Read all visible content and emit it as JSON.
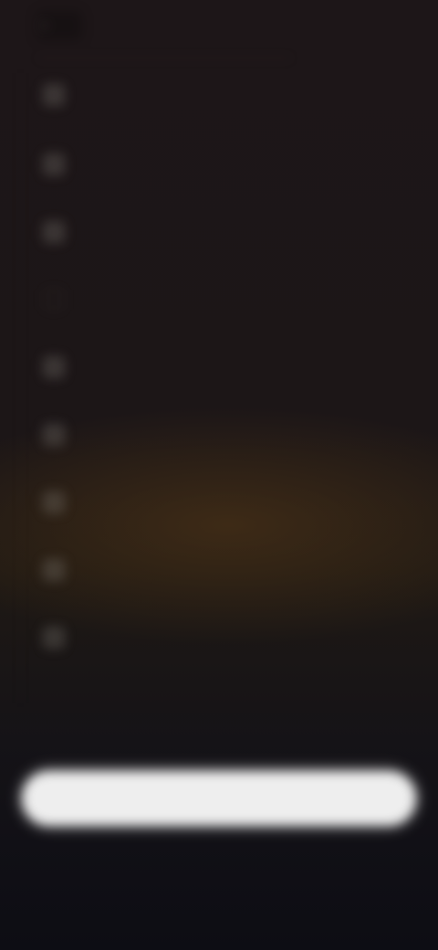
{
  "header": {
    "back_label": "",
    "action_label": ""
  },
  "menu": {
    "items": [
      {
        "icon": "square-icon",
        "label": ""
      },
      {
        "icon": "square-icon",
        "label": ""
      },
      {
        "icon": "square-icon",
        "label": ""
      },
      {
        "icon": "square-icon",
        "label": ""
      },
      {
        "icon": "square-icon",
        "label": ""
      },
      {
        "icon": "square-icon",
        "label": ""
      },
      {
        "icon": "square-icon",
        "label": ""
      },
      {
        "icon": "square-icon",
        "label": ""
      },
      {
        "icon": "square-icon",
        "label": ""
      }
    ]
  },
  "footer": {
    "left_text": "",
    "right_text": ""
  },
  "actions": {
    "primary_label": "",
    "secondary_label": ""
  },
  "colors": {
    "background_top": "#1d1618",
    "background_bottom": "#0d0d14",
    "warm_glow": "#4e3416",
    "button": "#eeeeee"
  }
}
